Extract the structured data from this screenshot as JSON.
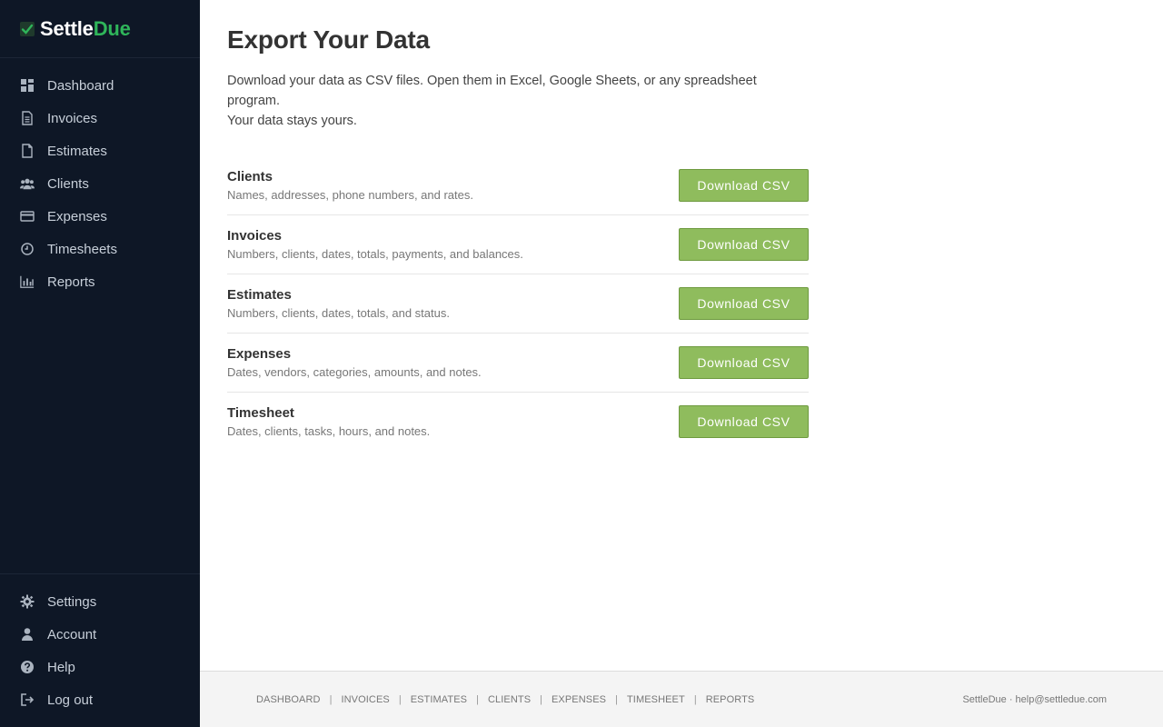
{
  "brand": {
    "part1": "Settle",
    "part2": "Due",
    "accent": "#2fb55a"
  },
  "sidebar": {
    "items": [
      {
        "label": "Dashboard",
        "icon": "dashboard-icon"
      },
      {
        "label": "Invoices",
        "icon": "invoice-icon"
      },
      {
        "label": "Estimates",
        "icon": "estimate-icon"
      },
      {
        "label": "Clients",
        "icon": "clients-icon"
      },
      {
        "label": "Expenses",
        "icon": "credit-card-icon"
      },
      {
        "label": "Timesheets",
        "icon": "clock-icon"
      },
      {
        "label": "Reports",
        "icon": "bar-chart-icon"
      }
    ],
    "bottom_items": [
      {
        "label": "Settings",
        "icon": "gear-icon"
      },
      {
        "label": "Account",
        "icon": "user-icon"
      },
      {
        "label": "Help",
        "icon": "help-icon"
      },
      {
        "label": "Log out",
        "icon": "logout-icon"
      }
    ]
  },
  "main": {
    "title": "Export Your Data",
    "intro_line1": "Download your data as CSV files. Open them in Excel, Google Sheets, or any spreadsheet program.",
    "intro_line2": "Your data stays yours.",
    "exports": [
      {
        "title": "Clients",
        "description": "Names, addresses, phone numbers, and rates.",
        "button": "Download CSV"
      },
      {
        "title": "Invoices",
        "description": "Numbers, clients, dates, totals, payments, and balances.",
        "button": "Download CSV"
      },
      {
        "title": "Estimates",
        "description": "Numbers, clients, dates, totals, and status.",
        "button": "Download CSV"
      },
      {
        "title": "Expenses",
        "description": "Dates, vendors, categories, amounts, and notes.",
        "button": "Download CSV"
      },
      {
        "title": "Timesheet",
        "description": "Dates, clients, tasks, hours, and notes.",
        "button": "Download CSV"
      }
    ],
    "button_color": "#8fbc5d"
  },
  "footer": {
    "links": [
      "DASHBOARD",
      "INVOICES",
      "ESTIMATES",
      "CLIENTS",
      "EXPENSES",
      "TIMESHEET",
      "REPORTS"
    ],
    "separator": "|",
    "right_text": "SettleDue · help@settledue.com"
  }
}
